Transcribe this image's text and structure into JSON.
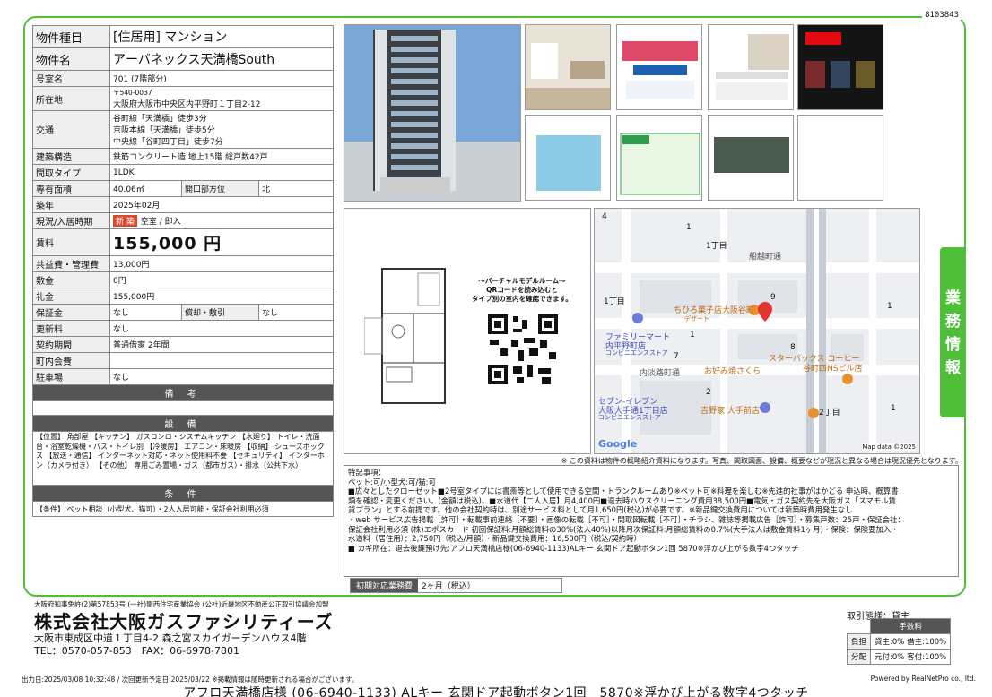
{
  "doc_id": "8103843",
  "property": {
    "type_label": "物件種目",
    "type_value": "[住居用] マンション",
    "name_label": "物件名",
    "name_value": "アーバネックス天満橋South",
    "room_label": "号室名",
    "room_value": "701 (7階部分)",
    "addr_label": "所在地",
    "addr_zip": "〒540-0037",
    "addr_value": "大阪府大阪市中央区内平野町１丁目2-12",
    "transit_label": "交通",
    "transit": [
      "谷町線「天満橋」徒歩3分",
      "京阪本線「天満橋」徒歩5分",
      "中央線「谷町四丁目」徒歩7分"
    ],
    "structure_label": "建築構造",
    "structure_value": "鉄筋コンクリート造 地上15階 総戸数42戸",
    "layout_label": "間取タイプ",
    "layout_value": "1LDK",
    "area_label": "専有面積",
    "area_value": "40.06㎡",
    "opening_label": "開口部方位",
    "opening_value": "北",
    "built_label": "築年",
    "built_value": "2025年02月",
    "status_label": "現況/入居時期",
    "status_badge": "新 築",
    "status_value": "空室 / 即入",
    "rent_label": "賃料",
    "rent_value": "155,000 円",
    "fee_label": "共益費・管理費",
    "fee_value": "13,000円",
    "deposit_label": "敷金",
    "deposit_value": "0円",
    "key_label": "礼金",
    "key_value": "155,000円",
    "guarantee_label": "保証金",
    "guarantee_value": "なし",
    "amort_label": "償却・敷引",
    "amort_value": "なし",
    "renewal_label": "更新料",
    "renewal_value": "なし",
    "contract_label": "契約期間",
    "contract_value": "普通借家 2年間",
    "town_label": "町内会費",
    "town_value": "",
    "parking_label": "駐車場",
    "parking_value": "なし"
  },
  "sections": {
    "biko": "備 考",
    "setsubi": "設 備",
    "setsubi_text": "【位置】 角部屋 【キッチン】 ガスコンロ・システムキッチン 【水廻り】 トイレ・洗面台・浴室乾燥機・バス・トイレ別 【冷暖房】 エアコン・床暖房 【収納】 シューズボックス 【放送・通信】 インターネット対応・ネット使用料不要 【セキュリティ】 インターホン（カメラ付き） 【その他】 専用ごみ置場・ガス（都市ガス）・排水（公共下水）",
    "joken": "条 件",
    "joken_text": "【条件】 ペット相談（小型犬、猫可）・2人入居可能・保証会社利用必須"
  },
  "vr": {
    "line1": "～バーチャルモデルルーム～",
    "line2": "QRコードを読み込むと",
    "line3": "タイプ別の室内を確認できます。"
  },
  "map": {
    "labels": [
      "4",
      "1",
      "1丁目",
      "船越町通",
      "1丁目",
      "9",
      "ちひろ菓子店大阪谷町",
      "デザート",
      "ファミリーマート",
      "内平野町店",
      "コンビニエンスストア",
      "8",
      "内淡路町通",
      "スターバックス コーヒー",
      "谷町四NSビル店",
      "お好み焼さくら",
      "セブン-イレブン",
      "大阪大手通1丁目店",
      "コンビニエンスストア",
      "吉野家 大手前店",
      "2丁目",
      "Google",
      "Map data ©2025",
      "1",
      "7",
      "2",
      "1",
      "1"
    ]
  },
  "photo_note": "※ この資料は物件の概略紹介資料になります。写真、間取図面、設備、概要などが現況と異なる場合は現況優先となります。",
  "remarks": {
    "title": "特記事項：",
    "lines": [
      "ペット:可/小型犬:可/猫:可",
      "■広々としたクローゼット■2号室タイプには書斎等として使用できる空間・トランクルームあり※ペット可※料理を楽しむ※先進的社事がはかどる 申込時、概算書",
      "類を確認・変更ください。(金額は税込)。■水道代【二人入居】月4,400円■退去時ハウスクリーニング費用38,500円■電気・ガス契約先を大阪ガス「スマモル賃",
      "貸プラン」とする前提です。他の会社契約時は、別途サービス料として月1,650円(税込)が必要です。※新品鍵交換費用については新築時費用発生なし",
      "・web サービス広告掲載［許可］・転載事前連絡［不要］・画像の転載［不可］・間取図転載［不可］・チラシ、雑誌等掲載広告［許可］・募集戸数：25戸・保証会社：",
      "保証会社利用必須 (株)エポスカード 初回保証料:月額総賃料の30%(法人40%)以降月次保証料:月額総賃料の0.7%(大手法人は敷金賃料1ヶ月)・保険：保険要加入・",
      "水道料（居住用）：2,750円（税込/月額）・新品鍵交換費用：16,500円（税込/契約時）",
      "■ カギ所在：退去後鍵預け先:アフロ天満橋店様(06-6940-1133)ALキー 玄関ドア起動ボタン1回 5870※浮かび上がる数字4つタッチ"
    ]
  },
  "initial": {
    "label": "初期対応業務費",
    "value": "2ヶ月（税込）"
  },
  "company": {
    "assoc": "大阪府知事免許(2)第57853号 (一社)関西住宅産業協会 (公社)近畿地区不動産公正取引協議会加盟",
    "name": "株式会社大阪ガスファシリティーズ",
    "address": "大阪市東成区中道１丁目4-2 森之宮スカイガーデンハウス4階",
    "tel": "TEL：0570-057-853　FAX：06-6978-7801"
  },
  "torihiki": {
    "label": "取引態様：貸主",
    "fee_header": "手数料",
    "burden_label": "負担",
    "burden_value": "貸主:0% 借主:100%",
    "split_label": "分配",
    "split_value": "元付:0% 客付:100%"
  },
  "side_tab": "業務情報",
  "footer": {
    "outdate": "出力日:2025/03/08 10:32:48 / 次回更新予定日:2025/03/22 ※掲載情報は随時更新される場合がございます。",
    "powered": "Powered by RealNetPro co., ltd.",
    "bottom": "アフロ天満橋店様 (06-6940-1133) ALキー 玄関ドア起動ボタン1回　5870※浮かび上がる数字4つタッチ"
  },
  "colors": {
    "frame": "#4fbf3a",
    "new_badge": "#d94a2a",
    "header_dark": "#555555"
  }
}
